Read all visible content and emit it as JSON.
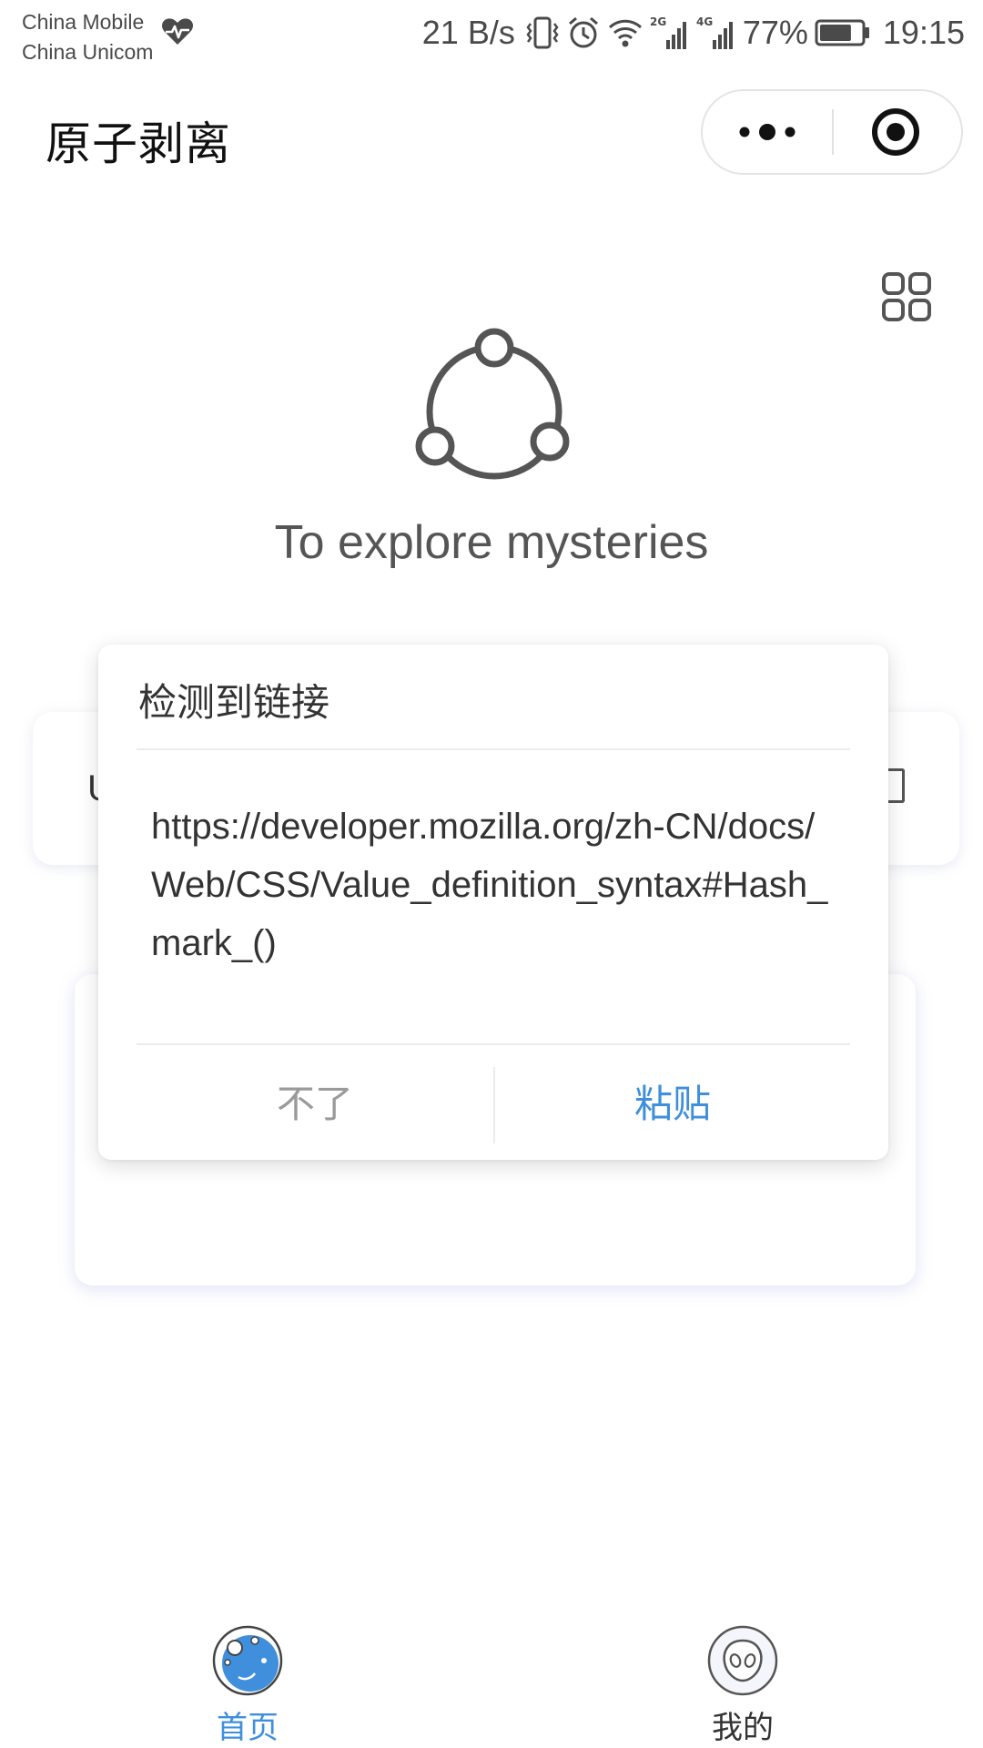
{
  "status_bar": {
    "carrier_1": "China Mobile",
    "carrier_2": "China Unicom",
    "net_speed": "21 B/s",
    "net_2g": "2G",
    "net_4g": "4G",
    "battery_percent": "77%",
    "battery_level": 0.77,
    "time": "19:15"
  },
  "header": {
    "title": "原子剥离",
    "more_icon": "more-dots-icon",
    "close_icon": "target-circle-icon"
  },
  "main": {
    "grid_icon": "grid-icon",
    "logo_icon": "share-nodes-icon",
    "tagline": "To explore mysteries",
    "input_stub": "U"
  },
  "dialog": {
    "title": "检测到链接",
    "url": "https://developer.mozilla.org/zh-CN/docs/Web/CSS/Value_definition_syntax#Hash_mark_()",
    "cancel_label": "不了",
    "confirm_label": "粘贴"
  },
  "tabbar": {
    "items": [
      {
        "label": "首页",
        "icon": "planet-icon",
        "active": true
      },
      {
        "label": "我的",
        "icon": "alien-face-icon",
        "active": false
      }
    ]
  },
  "colors": {
    "accent": "#3f8fdc",
    "muted": "#9a9a9a",
    "text": "#333333"
  }
}
